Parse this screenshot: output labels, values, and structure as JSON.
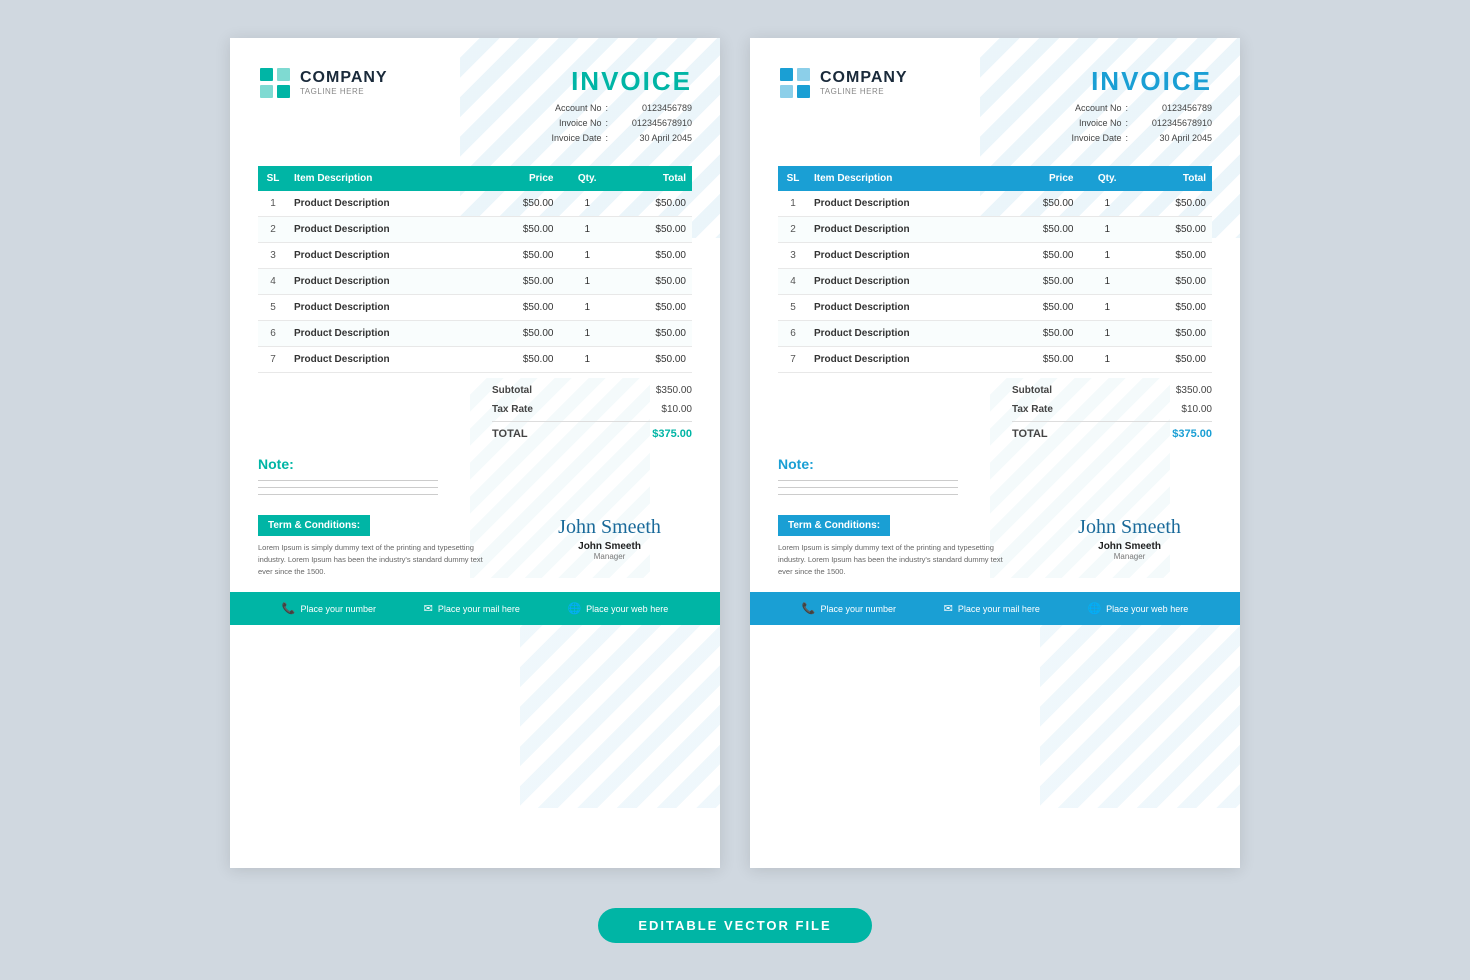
{
  "page": {
    "background": "#d0d8e0",
    "badge_label": "EDITABLE VECTOR  FILE"
  },
  "invoices": [
    {
      "id": "left",
      "theme": "teal",
      "company": {
        "name": "COMPANY",
        "tagline": "TAGLINE HERE"
      },
      "title": "INVOICE",
      "meta": {
        "account_no_label": "Account No",
        "account_no_value": "0123456789",
        "invoice_no_label": "Invoice No",
        "invoice_no_value": "012345678910",
        "invoice_date_label": "Invoice Date",
        "invoice_date_value": "30 April 2045"
      },
      "table": {
        "headers": [
          "SL",
          "Item Description",
          "Price",
          "Qty.",
          "Total"
        ],
        "rows": [
          {
            "sl": 1,
            "desc": "Product Description",
            "price": "$50.00",
            "qty": 1,
            "total": "$50.00"
          },
          {
            "sl": 2,
            "desc": "Product Description",
            "price": "$50.00",
            "qty": 1,
            "total": "$50.00"
          },
          {
            "sl": 3,
            "desc": "Product Description",
            "price": "$50.00",
            "qty": 1,
            "total": "$50.00"
          },
          {
            "sl": 4,
            "desc": "Product Description",
            "price": "$50.00",
            "qty": 1,
            "total": "$50.00"
          },
          {
            "sl": 5,
            "desc": "Product Description",
            "price": "$50.00",
            "qty": 1,
            "total": "$50.00"
          },
          {
            "sl": 6,
            "desc": "Product Description",
            "price": "$50.00",
            "qty": 1,
            "total": "$50.00"
          },
          {
            "sl": 7,
            "desc": "Product Description",
            "price": "$50.00",
            "qty": 1,
            "total": "$50.00"
          }
        ]
      },
      "totals": {
        "subtotal_label": "Subtotal",
        "subtotal_value": "$350.00",
        "tax_label": "Tax Rate",
        "tax_value": "$10.00",
        "total_label": "TOTAL",
        "total_value": "$375.00"
      },
      "note": {
        "title": "Note:"
      },
      "terms": {
        "title": "Term & Conditions:",
        "text": "Lorem Ipsum is simply dummy text of the printing and typesetting industry. Lorem Ipsum has been the industry's standard dummy text ever since the 1500."
      },
      "signature": {
        "script": "John Smeeth",
        "name": "John Smeeth",
        "role": "Manager"
      },
      "footer": {
        "phone": "Place your number",
        "email": "Place your mail here",
        "web": "Place your web here"
      }
    },
    {
      "id": "right",
      "theme": "blue",
      "company": {
        "name": "COMPANY",
        "tagline": "TAGLINE HERE"
      },
      "title": "INVOICE",
      "meta": {
        "account_no_label": "Account No",
        "account_no_value": "0123456789",
        "invoice_no_label": "Invoice No",
        "invoice_no_value": "012345678910",
        "invoice_date_label": "Invoice Date",
        "invoice_date_value": "30 April 2045"
      },
      "table": {
        "headers": [
          "SL",
          "Item Description",
          "Price",
          "Qty.",
          "Total"
        ],
        "rows": [
          {
            "sl": 1,
            "desc": "Product Description",
            "price": "$50.00",
            "qty": 1,
            "total": "$50.00"
          },
          {
            "sl": 2,
            "desc": "Product Description",
            "price": "$50.00",
            "qty": 1,
            "total": "$50.00"
          },
          {
            "sl": 3,
            "desc": "Product Description",
            "price": "$50.00",
            "qty": 1,
            "total": "$50.00"
          },
          {
            "sl": 4,
            "desc": "Product Description",
            "price": "$50.00",
            "qty": 1,
            "total": "$50.00"
          },
          {
            "sl": 5,
            "desc": "Product Description",
            "price": "$50.00",
            "qty": 1,
            "total": "$50.00"
          },
          {
            "sl": 6,
            "desc": "Product Description",
            "price": "$50.00",
            "qty": 1,
            "total": "$50.00"
          },
          {
            "sl": 7,
            "desc": "Product Description",
            "price": "$50.00",
            "qty": 1,
            "total": "$50.00"
          }
        ]
      },
      "totals": {
        "subtotal_label": "Subtotal",
        "subtotal_value": "$350.00",
        "tax_label": "Tax Rate",
        "tax_value": "$10.00",
        "total_label": "TOTAL",
        "total_value": "$375.00"
      },
      "note": {
        "title": "Note:"
      },
      "terms": {
        "title": "Term & Conditions:",
        "text": "Lorem Ipsum is simply dummy text of the printing and typesetting industry. Lorem Ipsum has been the industry's standard dummy text ever since the 1500."
      },
      "signature": {
        "script": "John Smeeth",
        "name": "John Smeeth",
        "role": "Manager"
      },
      "footer": {
        "phone": "Place your number",
        "email": "Place your mail here",
        "web": "Place your web here"
      }
    }
  ]
}
